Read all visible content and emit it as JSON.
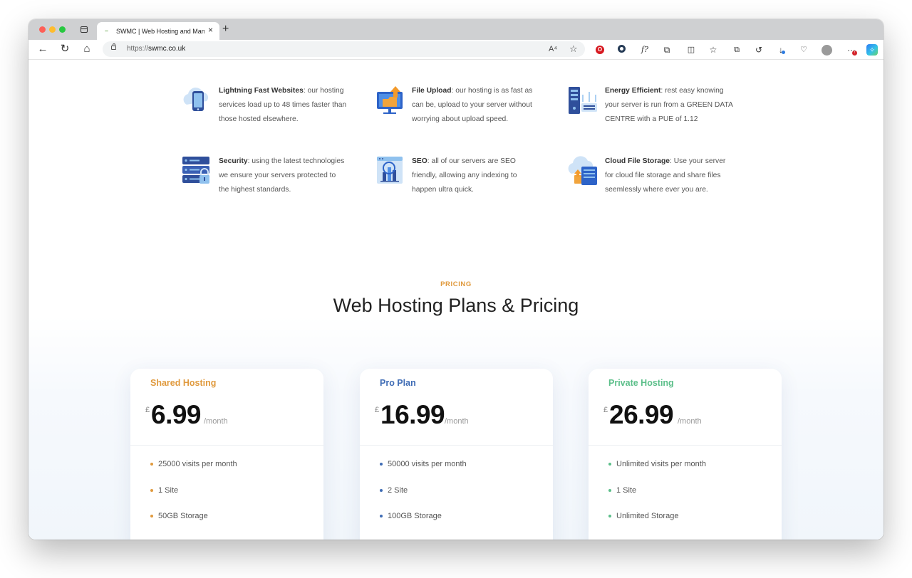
{
  "browser": {
    "tab": {
      "title": "SWMC | Web Hosting and Man",
      "close": "×",
      "favicon": "–"
    },
    "new_tab": "+",
    "url_scheme": "https://",
    "url_host": "swmc.co.uk",
    "read_aloud_icon_text": "A⁴",
    "extension_f_text": "f?",
    "copilot_text": "✧"
  },
  "features": [
    {
      "title": "Lightning Fast Websites",
      "text": ": our hosting services load up to 48 times faster than those hosted elsewhere.",
      "icon": "cloud-phone-icon"
    },
    {
      "title": "File Upload",
      "text": ": our hosting is as fast as can be, upload to your server without worrying about upload speed.",
      "icon": "file-upload-icon"
    },
    {
      "title": "Energy Efficient",
      "text": ": rest easy knowing your server is run from a GREEN DATA CENTRE with a PUE of 1.12",
      "icon": "server-tower-icon"
    },
    {
      "title": "Security",
      "text": ": using the latest technologies we ensure your servers protected to the highest standards.",
      "icon": "server-lock-icon"
    },
    {
      "title": "SEO",
      "text": ": all of our servers are SEO friendly, allowing any indexing to happen ultra quick.",
      "icon": "seo-chart-icon"
    },
    {
      "title": "Cloud File Storage",
      "text": ": Use your server for cloud file storage and share files seemlessly where ever you are.",
      "icon": "cloud-storage-icon"
    }
  ],
  "pricing": {
    "label": "PRICING",
    "title": "Web Hosting Plans & Pricing",
    "plans": [
      {
        "name": "Shared Hosting",
        "color": "#e09a3e",
        "currency": "£",
        "price": "6.99",
        "period": "/month",
        "features": [
          "25000 visits per month",
          "1 Site",
          "50GB Storage"
        ]
      },
      {
        "name": "Pro Plan",
        "color": "#3f6cb5",
        "currency": "£",
        "price": "16.99",
        "period": "/month",
        "features": [
          "50000 visits per month",
          "2 Site",
          "100GB Storage"
        ]
      },
      {
        "name": "Private Hosting",
        "color": "#5cbf8a",
        "currency": "£",
        "price": "26.99",
        "period": "/month",
        "features": [
          "Unlimited visits per month",
          "1 Site",
          "Unlimited Storage"
        ]
      }
    ]
  }
}
